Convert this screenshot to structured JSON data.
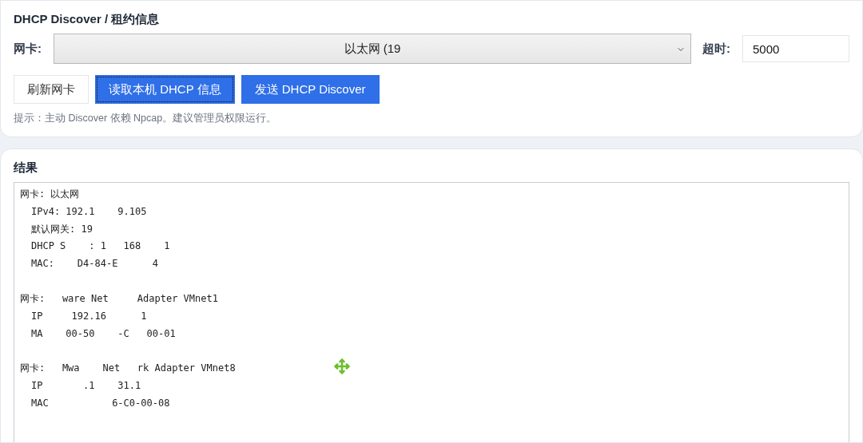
{
  "discover_panel": {
    "title": "DHCP Discover / 租约信息",
    "adapter_label": "网卡:",
    "adapter_select": {
      "value": "以太网 (19"
    },
    "timeout_label": "超时:",
    "timeout_field": {
      "value": "5000"
    },
    "buttons": [
      {
        "label": "刷新网卡",
        "kind": "secondary",
        "focused": false
      },
      {
        "label": "读取本机 DHCP 信息",
        "kind": "primary",
        "focused": true
      },
      {
        "label": "发送 DHCP Discover",
        "kind": "primary",
        "focused": false
      }
    ],
    "hint": "提示：主动 Discover 依赖 Npcap。建议管理员权限运行。"
  },
  "results_panel": {
    "title": "结果",
    "adapters": [
      {
        "header": "网卡: 以太网",
        "lines": [
          "IPv4: 192.1    9.105",
          "默认网关: 19",
          "DHCP S    : 1   168    1",
          "MAC:    D4-84-E      4"
        ]
      },
      {
        "header": "网卡:   ware Net     Adapter VMnet1",
        "lines": [
          "IP     192.16      1",
          "MA    00-50    -C   00-01"
        ]
      },
      {
        "header": "网卡:   Mwa    Net   rk Adapter VMnet8",
        "lines": [
          "IP       .1    31.1",
          "MAC           6-C0-00-08"
        ]
      }
    ]
  }
}
